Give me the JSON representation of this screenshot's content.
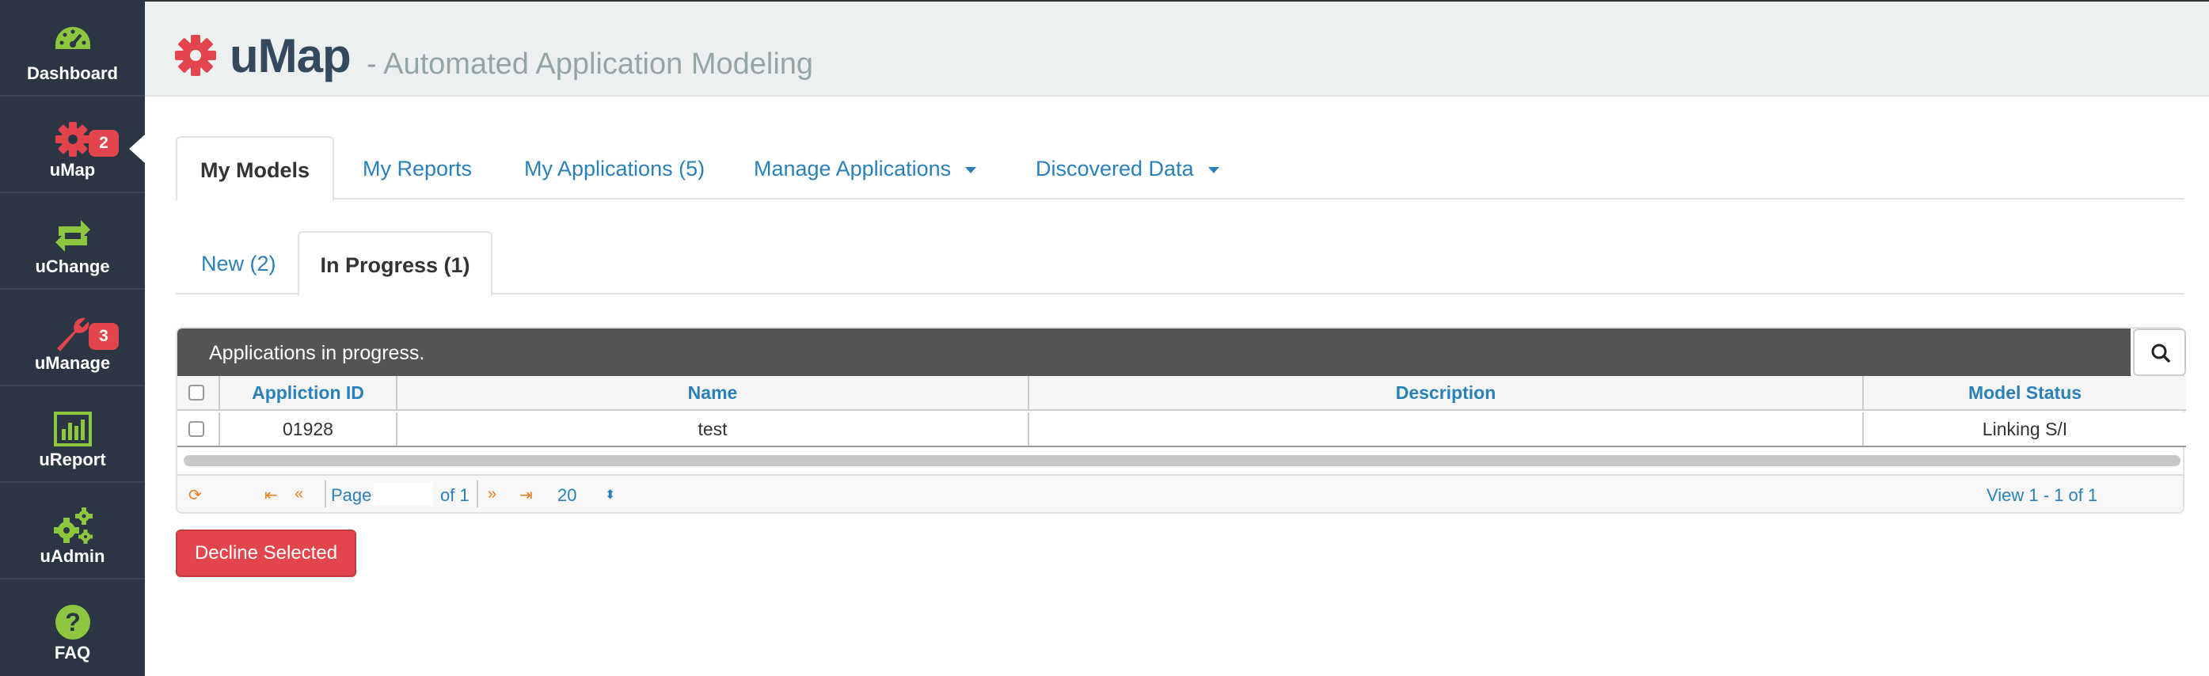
{
  "sidebar": {
    "items": [
      {
        "label": "Dashboard",
        "icon": "speedometer-icon",
        "color": "#8dc63f"
      },
      {
        "label": "uMap",
        "icon": "gear-icon",
        "color": "#e2464c",
        "badge": "2"
      },
      {
        "label": "uChange",
        "icon": "swap-arrows-icon",
        "color": "#8dc63f"
      },
      {
        "label": "uManage",
        "icon": "wrench-icon",
        "color": "#e2464c",
        "badge": "3"
      },
      {
        "label": "uReport",
        "icon": "bar-chart-icon",
        "color": "#8dc63f"
      },
      {
        "label": "uAdmin",
        "icon": "gears-icon",
        "color": "#8dc63f"
      },
      {
        "label": "FAQ",
        "icon": "question-circle-icon",
        "color": "#8dc63f"
      }
    ]
  },
  "header": {
    "brand": "uMap",
    "subtitle": "- Automated Application Modeling",
    "logo_icon": "gear-icon",
    "logo_color": "#e2464c"
  },
  "tabs": [
    {
      "label": "My Models",
      "active": true
    },
    {
      "label": "My Reports"
    },
    {
      "label": "My Applications (5)"
    },
    {
      "label": "Manage Applications",
      "dropdown": true
    },
    {
      "label": "Discovered Data",
      "dropdown": true
    }
  ],
  "subtabs": [
    {
      "label": "New (2)"
    },
    {
      "label": "In Progress (1)",
      "active": true
    }
  ],
  "grid": {
    "caption": "Applications in progress.",
    "columns": [
      "Appliction ID",
      "Name",
      "Description",
      "Model Status"
    ],
    "rows": [
      {
        "id": "01928",
        "name": "test",
        "description": "",
        "status": "Linking S/I",
        "checked": false
      }
    ],
    "pager": {
      "page_label": "Page",
      "page_value": "",
      "of_label": "of 1",
      "page_size": "20",
      "view_text": "View 1 - 1 of 1"
    }
  },
  "actions": {
    "decline_label": "Decline Selected"
  }
}
